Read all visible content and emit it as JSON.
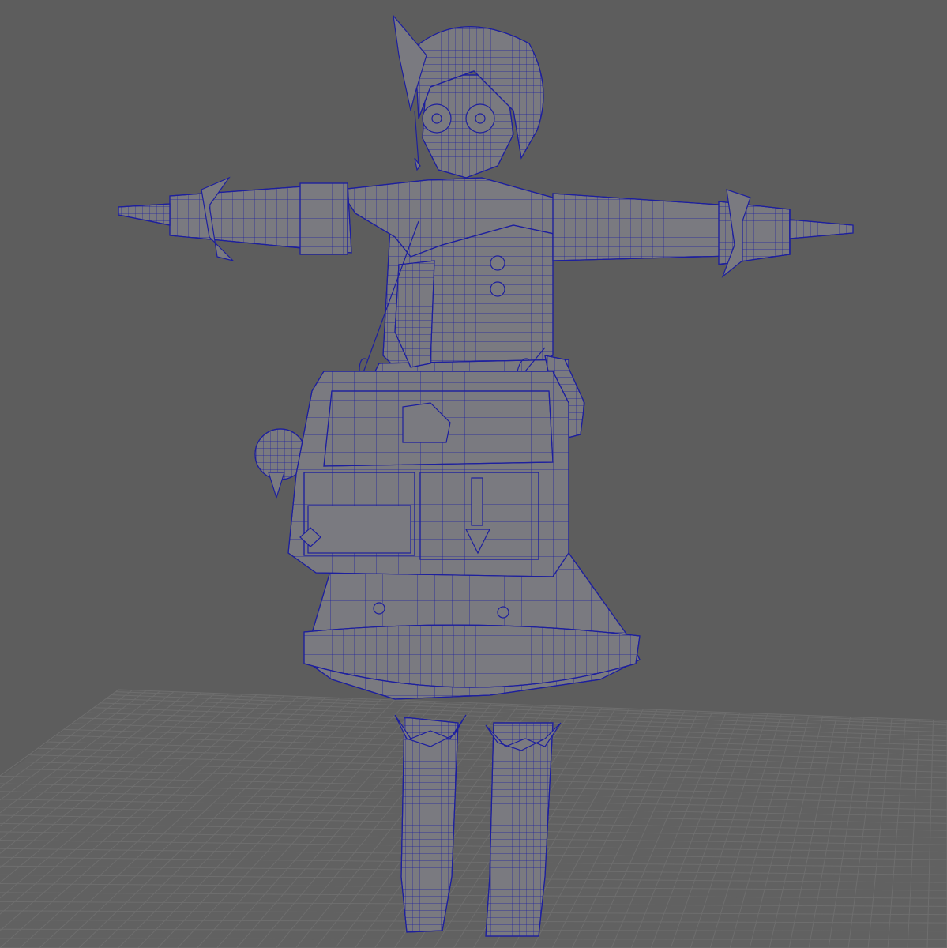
{
  "viewport": {
    "panel": "perspective-viewport",
    "background_color": "#5d5d5d",
    "grid_color": "#6e6e6e",
    "grid_visible": true,
    "wireframe_on_shaded": true
  },
  "model": {
    "pose": "T-pose",
    "shade_color": "#7a7a80",
    "wire_color": "#1d1f9e",
    "parts": [
      "hair",
      "hair-ornament",
      "glasses-face",
      "collar",
      "jacket",
      "left-arm",
      "right-arm",
      "necktie",
      "shoulder-strap",
      "messenger-bag",
      "hanging-pouch",
      "side-pouch",
      "skirt",
      "skirt-frill",
      "left-boot",
      "right-boot"
    ]
  }
}
